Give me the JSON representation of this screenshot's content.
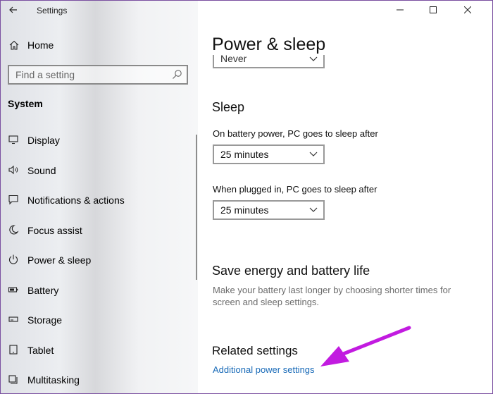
{
  "window": {
    "title": "Settings",
    "back_icon": "back-arrow-icon",
    "controls": [
      "minimize-icon",
      "maximize-icon",
      "close-icon"
    ]
  },
  "sidebar": {
    "home_label": "Home",
    "search": {
      "placeholder": "Find a setting",
      "value": ""
    },
    "section_title": "System",
    "items": [
      {
        "label": "Display",
        "icon": "display-icon"
      },
      {
        "label": "Sound",
        "icon": "speaker-icon"
      },
      {
        "label": "Notifications & actions",
        "icon": "notifications-icon"
      },
      {
        "label": "Focus assist",
        "icon": "moon-icon"
      },
      {
        "label": "Power & sleep",
        "icon": "power-icon"
      },
      {
        "label": "Battery",
        "icon": "battery-icon"
      },
      {
        "label": "Storage",
        "icon": "storage-icon"
      },
      {
        "label": "Tablet",
        "icon": "tablet-icon"
      },
      {
        "label": "Multitasking",
        "icon": "multitasking-icon"
      }
    ]
  },
  "main": {
    "page_title": "Power & sleep",
    "screen_dropdown_value": "Never",
    "sleep": {
      "heading": "Sleep",
      "battery_label": "On battery power, PC goes to sleep after",
      "battery_value": "25 minutes",
      "plugged_label": "When plugged in, PC goes to sleep after",
      "plugged_value": "25 minutes"
    },
    "save_energy": {
      "heading": "Save energy and battery life",
      "description": "Make your battery last longer by choosing shorter times for screen and sleep settings."
    },
    "related": {
      "heading": "Related settings",
      "link": "Additional power settings"
    }
  },
  "colors": {
    "link": "#1a6bb8",
    "annotation_arrow": "#c21be0",
    "window_border": "#7a4fa0"
  }
}
